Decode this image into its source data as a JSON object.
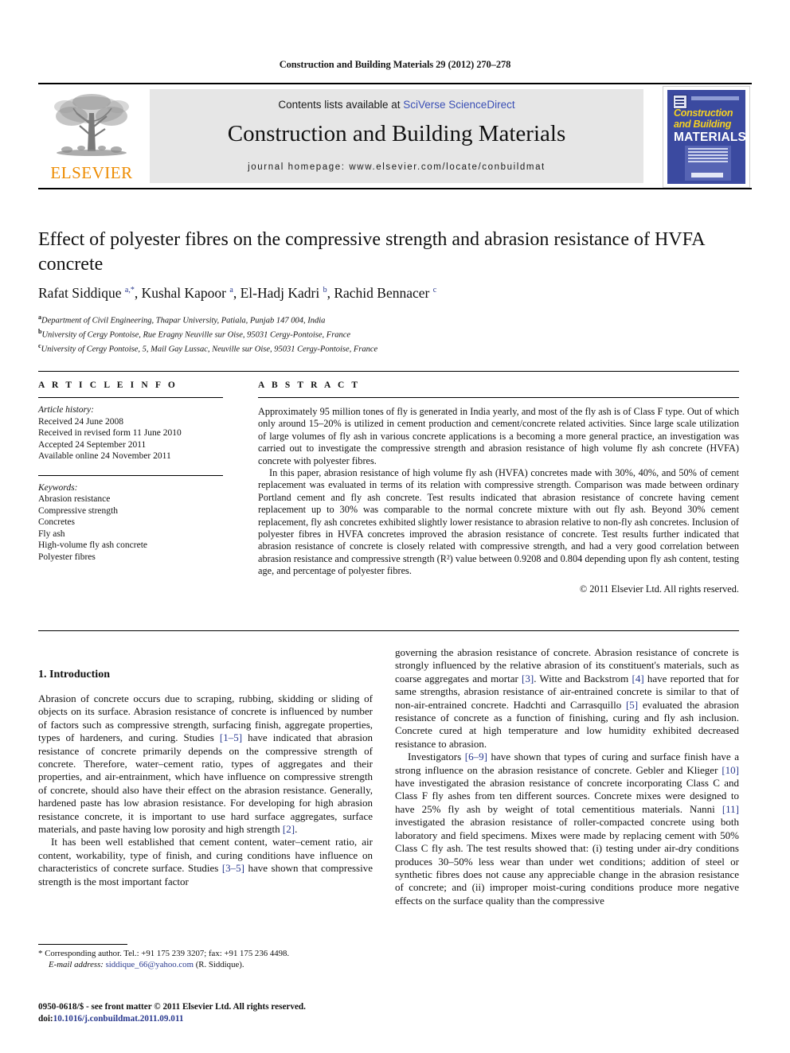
{
  "running_head": "Construction and Building Materials 29 (2012) 270–278",
  "masthead": {
    "contents_prefix": "Contents lists available at ",
    "sciencedirect": "SciVerse ScienceDirect",
    "journal_name": "Construction and Building Materials",
    "homepage": "journal homepage: www.elsevier.com/locate/conbuildmat",
    "publisher": "ELSEVIER",
    "cover": {
      "line1": "Construction",
      "line2": "and Building",
      "line3": "MATERIALS"
    },
    "colors": {
      "band_bg": "#e6e6e6",
      "link_blue": "#3a4fb5",
      "elsevier_orange": "#ED8B00",
      "cover_blue": "#3b4aa0",
      "cover_yellow": "#f5d020"
    }
  },
  "article": {
    "title": "Effect of polyester fibres on the compressive strength and abrasion resistance of HVFA concrete",
    "authors_html": "Rafat Siddique <sup>a,*</sup>, Kushal Kapoor <sup>a</sup>, El-Hadj Kadri <sup>b</sup>, Rachid Bennacer <sup>c</sup>",
    "affiliations": [
      {
        "marker": "a",
        "text": "Department of Civil Engineering, Thapar University, Patiala, Punjab 147 004, India"
      },
      {
        "marker": "b",
        "text": "University of Cergy Pontoise, Rue Eragny Neuville sur Oise, 95031 Cergy-Pontoise, France"
      },
      {
        "marker": "c",
        "text": "University of Cergy Pontoise, 5, Mail Gay Lussac, Neuville sur Oise, 95031 Cergy-Pontoise, France"
      }
    ]
  },
  "article_info": {
    "heading": "A R T I C L E   I N F O",
    "history_label": "Article history:",
    "history": [
      "Received 24 June 2008",
      "Received in revised form 11 June 2010",
      "Accepted 24 September 2011",
      "Available online 24 November 2011"
    ],
    "keywords_label": "Keywords:",
    "keywords": [
      "Abrasion resistance",
      "Compressive strength",
      "Concretes",
      "Fly ash",
      "High-volume fly ash concrete",
      "Polyester fibres"
    ]
  },
  "abstract": {
    "heading": "A B S T R A C T",
    "paragraphs": [
      "Approximately 95 million tones of fly is generated in India yearly, and most of the fly ash is of Class F type. Out of which only around 15–20% is utilized in cement production and cement/concrete related activities. Since large scale utilization of large volumes of fly ash in various concrete applications is a becoming a more general practice, an investigation was carried out to investigate the compressive strength and abrasion resistance of high volume fly ash concrete (HVFA) concrete with polyester fibres.",
      "In this paper, abrasion resistance of high volume fly ash (HVFA) concretes made with 30%, 40%, and 50% of cement replacement was evaluated in terms of its relation with compressive strength. Comparison was made between ordinary Portland cement and fly ash concrete. Test results indicated that abrasion resistance of concrete having cement replacement up to 30% was comparable to the normal concrete mixture with out fly ash. Beyond 30% cement replacement, fly ash concretes exhibited slightly lower resistance to abrasion relative to non-fly ash concretes. Inclusion of polyester fibres in HVFA concretes improved the abrasion resistance of concrete. Test results further indicated that abrasion resistance of concrete is closely related with compressive strength, and had a very good correlation between abrasion resistance and compressive strength (R²) value between 0.9208 and 0.804 depending upon fly ash content, testing age, and percentage of polyester fibres."
    ],
    "copyright": "© 2011 Elsevier Ltd. All rights reserved."
  },
  "introduction": {
    "heading": "1. Introduction",
    "left_paragraphs": [
      "Abrasion of concrete occurs due to scraping, rubbing, skidding or sliding of objects on its surface. Abrasion resistance of concrete is influenced by number of factors such as compressive strength, surfacing finish, aggregate properties, types of hardeners, and curing. Studies [1–5] have indicated that abrasion resistance of concrete primarily depends on the compressive strength of concrete. Therefore, water–cement ratio, types of aggregates and their properties, and air-entrainment, which have influence on compressive strength of concrete, should also have their effect on the abrasion resistance. Generally, hardened paste has low abrasion resistance. For developing for high abrasion resistance concrete, it is important to use hard surface aggregates, surface materials, and paste having low porosity and high strength [2].",
      "It has been well established that cement content, water–cement ratio, air content, workability, type of finish, and curing conditions have influence on characteristics of concrete surface. Studies [3–5] have shown that compressive strength is the most important factor"
    ],
    "right_paragraphs": [
      "governing the abrasion resistance of concrete. Abrasion resistance of concrete is strongly influenced by the relative abrasion of its constituent's materials, such as coarse aggregates and mortar [3]. Witte and Backstrom [4] have reported that for same strengths, abrasion resistance of air-entrained concrete is similar to that of non-air-entrained concrete. Hadchti and Carrasquillo [5] evaluated the abrasion resistance of concrete as a function of finishing, curing and fly ash inclusion. Concrete cured at high temperature and low humidity exhibited decreased resistance to abrasion.",
      "Investigators [6–9] have shown that types of curing and surface finish have a strong influence on the abrasion resistance of concrete. Gebler and Klieger [10] have investigated the abrasion resistance of concrete incorporating Class C and Class F fly ashes from ten different sources. Concrete mixes were designed to have 25% fly ash by weight of total cementitious materials. Nanni [11] investigated the abrasion resistance of roller-compacted concrete using both laboratory and field specimens. Mixes were made by replacing cement with 50% Class C fly ash. The test results showed that: (i) testing under air-dry conditions produces 30–50% less wear than under wet conditions; addition of steel or synthetic fibres does not cause any appreciable change in the abrasion resistance of concrete; and (ii) improper moist-curing conditions produce more negative effects on the surface quality than the compressive"
    ]
  },
  "footer": {
    "corresponding_star": "*",
    "corresponding_text": "Corresponding author. Tel.: +91 175 239 3207; fax: +91 175 236 4498.",
    "email_label": "E-mail address:",
    "email": "siddique_66@yahoo.com",
    "email_suffix": "(R. Siddique).",
    "issn_line": "0950-0618/$ - see front matter © 2011 Elsevier Ltd. All rights reserved.",
    "doi_label": "doi:",
    "doi": "10.1016/j.conbuildmat.2011.09.011"
  }
}
